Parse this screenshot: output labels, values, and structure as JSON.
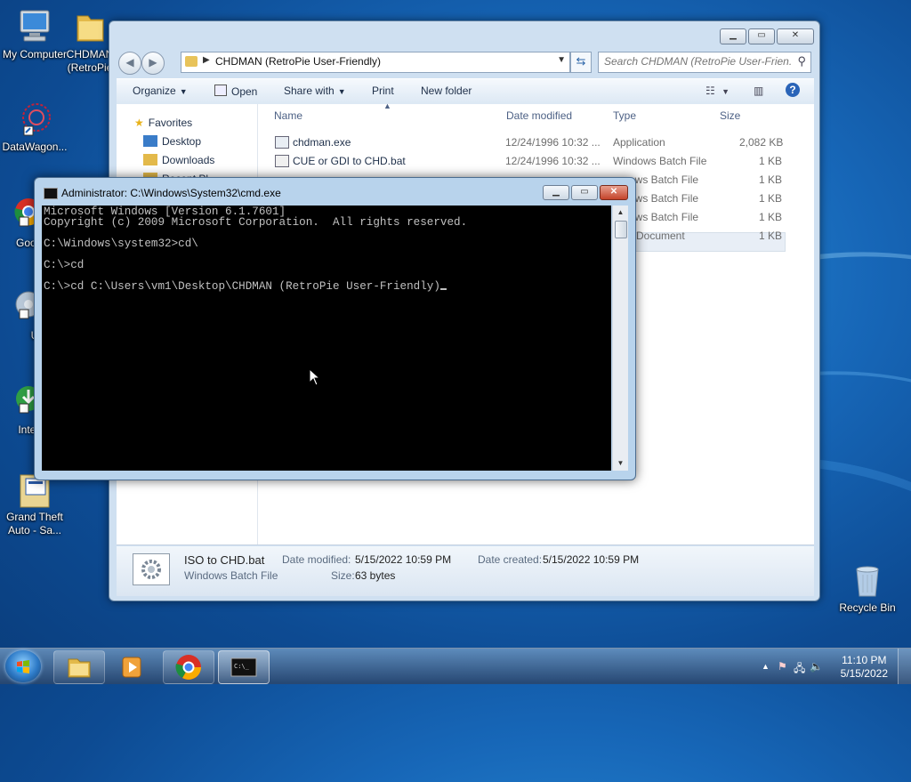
{
  "desktop": {
    "icons": [
      {
        "label": "My Computer",
        "icon": "computer-icon"
      },
      {
        "label": "CHDMAN (RetroPie",
        "icon": "folder-icon"
      },
      {
        "label": "DataWagon...",
        "icon": "datawagon-icon"
      },
      {
        "label": "Goo Chro",
        "icon": "chrome-shortcut-icon"
      },
      {
        "label": "Ultr",
        "icon": "ultra-shortcut-icon"
      },
      {
        "label": "Inte Dow",
        "icon": "internet-download-shortcut-icon"
      },
      {
        "label": "Grand Theft Auto - Sa...",
        "icon": "gta-icon"
      },
      {
        "label": "Recycle Bin",
        "icon": "recycle-bin-icon"
      }
    ]
  },
  "explorer": {
    "address_path": "CHDMAN (RetroPie User-Friendly)",
    "search_placeholder": "Search CHDMAN (RetroPie User-Frien...",
    "toolbar": {
      "organize": "Organize",
      "open": "Open",
      "share_with": "Share with",
      "print": "Print",
      "new_folder": "New folder"
    },
    "nav": {
      "favorites": "Favorites",
      "desktop": "Desktop",
      "downloads": "Downloads",
      "recent": "Recent Pl..."
    },
    "columns": {
      "name": "Name",
      "date_modified": "Date modified",
      "type": "Type",
      "size": "Size"
    },
    "files": [
      {
        "name": "chdman.exe",
        "date": "12/24/1996 10:32 ...",
        "type": "Application",
        "size": "2,082 KB"
      },
      {
        "name": "CUE or GDI to CHD.bat",
        "date": "12/24/1996 10:32 ...",
        "type": "Windows Batch File",
        "size": "1 KB"
      },
      {
        "name": "",
        "date": "",
        "type": "ows Batch File",
        "size": "1 KB"
      },
      {
        "name": "",
        "date": "",
        "type": "ows Batch File",
        "size": "1 KB"
      },
      {
        "name": "",
        "date": "",
        "type": "ows Batch File",
        "size": "1 KB"
      },
      {
        "name": "",
        "date": "",
        "type": "Document",
        "size": "1 KB"
      }
    ],
    "details": {
      "filename": "ISO to CHD.bat",
      "filetype": "Windows Batch File",
      "date_modified_label": "Date modified:",
      "date_modified": "5/15/2022 10:59 PM",
      "date_created_label": "Date created:",
      "date_created": "5/15/2022 10:59 PM",
      "size_label": "Size:",
      "size": "63 bytes"
    }
  },
  "cmd": {
    "title": "Administrator: C:\\Windows\\System32\\cmd.exe",
    "lines": [
      "Microsoft Windows [Version 6.1.7601]",
      "Copyright (c) 2009 Microsoft Corporation.  All rights reserved.",
      "",
      "C:\\Windows\\system32>cd\\",
      "",
      "C:\\>cd",
      "",
      "C:\\>cd C:\\Users\\vm1\\Desktop\\CHDMAN (RetroPie User-Friendly)"
    ]
  },
  "taskbar": {
    "time": "11:10 PM",
    "date": "5/15/2022"
  }
}
